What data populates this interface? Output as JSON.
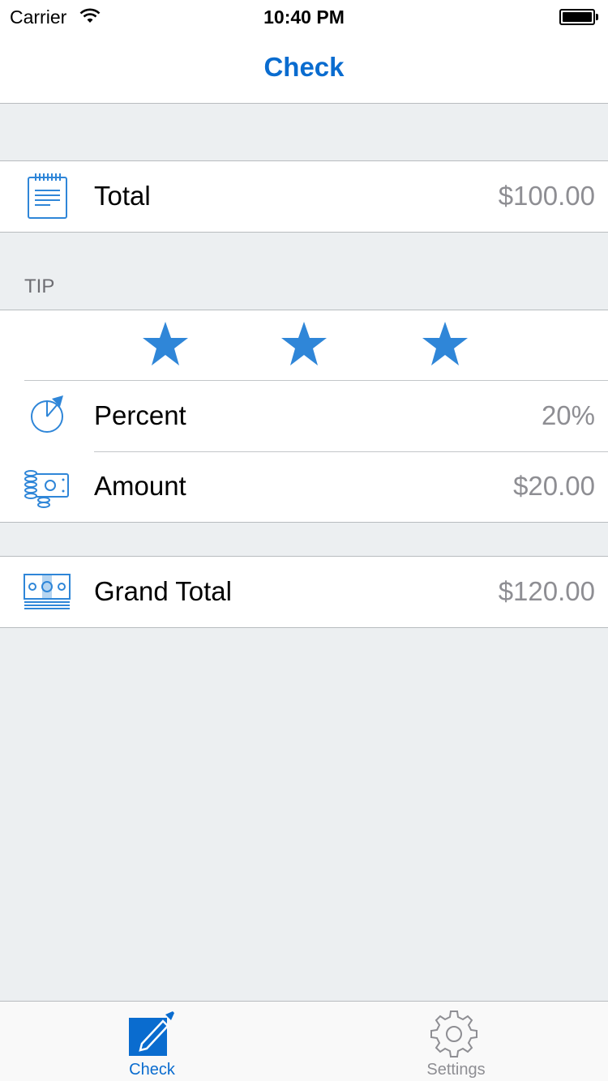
{
  "status_bar": {
    "carrier": "Carrier",
    "time": "10:40 PM",
    "wifi_icon": "wifi-icon",
    "battery_icon": "battery-full-icon"
  },
  "nav": {
    "title": "Check"
  },
  "check": {
    "total_label": "Total",
    "total_value": "$100.00",
    "total_icon": "receipt-icon"
  },
  "tip": {
    "section_label": "TIP",
    "stars_selected": 3,
    "stars_total": 3,
    "percent_label": "Percent",
    "percent_value": "20%",
    "percent_icon": "pie-chart-icon",
    "amount_label": "Amount",
    "amount_value": "$20.00",
    "amount_icon": "coins-bill-icon"
  },
  "grand_total": {
    "label": "Grand Total",
    "value": "$120.00",
    "icon": "banknotes-icon"
  },
  "tab_bar": {
    "tabs": [
      {
        "label": "Check",
        "icon": "edit-icon",
        "selected": true
      },
      {
        "label": "Settings",
        "icon": "gear-icon",
        "selected": false
      }
    ]
  },
  "colors": {
    "accent": "#0a6ccf",
    "icon_blue": "#2f86d8",
    "value_gray": "#8e8e93",
    "background": "#eceff1",
    "tab_inactive": "#8e8e93"
  }
}
